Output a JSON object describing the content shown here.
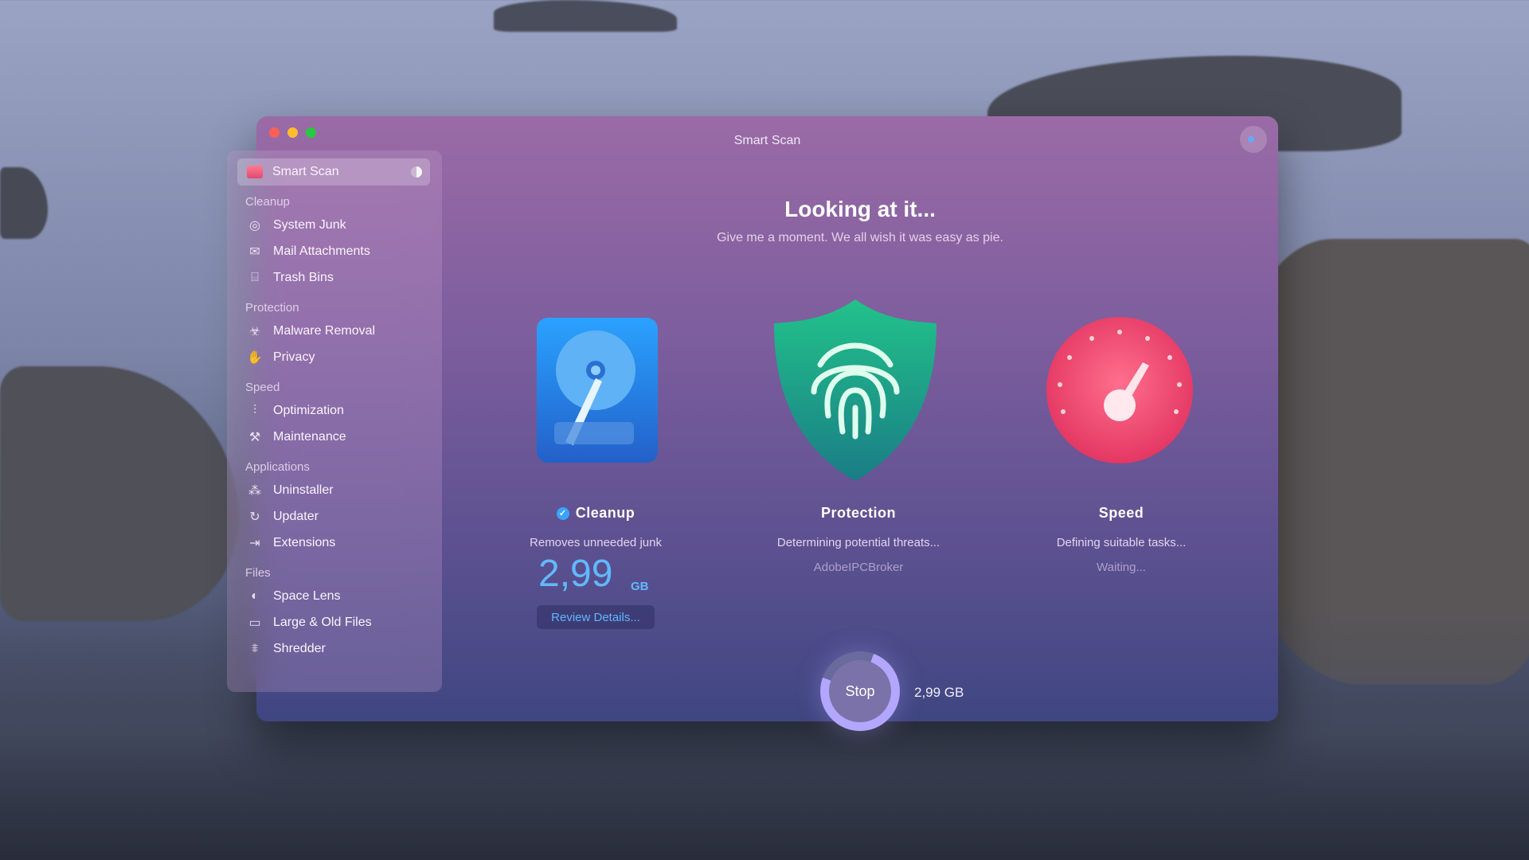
{
  "window": {
    "title": "Smart Scan"
  },
  "sidebar": {
    "active": {
      "label": "Smart Scan",
      "icon": "smart-scan-icon"
    },
    "sections": [
      {
        "heading": "Cleanup",
        "items": [
          {
            "label": "System Junk",
            "icon": "system-junk-icon"
          },
          {
            "label": "Mail Attachments",
            "icon": "mail-icon"
          },
          {
            "label": "Trash Bins",
            "icon": "trash-icon"
          }
        ]
      },
      {
        "heading": "Protection",
        "items": [
          {
            "label": "Malware Removal",
            "icon": "biohazard-icon"
          },
          {
            "label": "Privacy",
            "icon": "hand-icon"
          }
        ]
      },
      {
        "heading": "Speed",
        "items": [
          {
            "label": "Optimization",
            "icon": "sliders-icon"
          },
          {
            "label": "Maintenance",
            "icon": "wrench-icon"
          }
        ]
      },
      {
        "heading": "Applications",
        "items": [
          {
            "label": "Uninstaller",
            "icon": "uninstaller-icon"
          },
          {
            "label": "Updater",
            "icon": "updater-icon"
          },
          {
            "label": "Extensions",
            "icon": "extensions-icon"
          }
        ]
      },
      {
        "heading": "Files",
        "items": [
          {
            "label": "Space Lens",
            "icon": "space-lens-icon"
          },
          {
            "label": "Large & Old Files",
            "icon": "folder-icon"
          },
          {
            "label": "Shredder",
            "icon": "shredder-icon"
          }
        ]
      }
    ]
  },
  "main": {
    "heading": "Looking at it...",
    "subheading": "Give me a moment. We all wish it was easy as pie.",
    "modules": {
      "cleanup": {
        "title": "Cleanup",
        "desc": "Removes unneeded junk",
        "size_value": "2,99",
        "size_unit": "GB",
        "review_label": "Review Details..."
      },
      "protection": {
        "title": "Protection",
        "desc": "Determining potential threats...",
        "extra": "AdobeIPCBroker"
      },
      "speed": {
        "title": "Speed",
        "desc": "Defining suitable tasks...",
        "extra": "Waiting..."
      }
    },
    "stop": {
      "label": "Stop",
      "size": "2,99 GB",
      "progress": 0.75
    }
  },
  "colors": {
    "accent": "#62b8ff",
    "check": "#3aa3ff"
  }
}
